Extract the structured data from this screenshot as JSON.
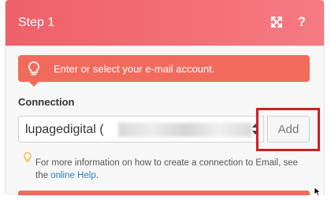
{
  "header": {
    "title": "Step 1"
  },
  "hint": {
    "text": "Enter or select your e-mail account."
  },
  "connection": {
    "label": "Connection",
    "selected_value": "lupagedigital (",
    "add_label": "Add"
  },
  "info": {
    "text": "For more information on how to create a connection to Email, see the ",
    "link_text": "online Help",
    "suffix": "."
  },
  "colors": {
    "header": "#f0606a",
    "hint": "#f26a5c",
    "highlight": "#cc1f1f",
    "link": "#2a7fc4"
  },
  "icons": [
    "expand-icon",
    "help-icon",
    "lightbulb-icon",
    "select-arrows-icon",
    "info-bulb-icon",
    "cursor-icon"
  ]
}
